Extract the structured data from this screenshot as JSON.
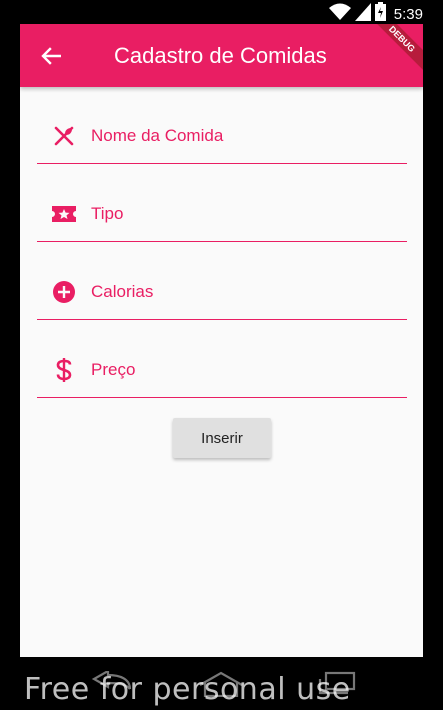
{
  "status_bar": {
    "time": "5:39",
    "icons": [
      "wifi-icon",
      "signal-icon",
      "battery-icon"
    ]
  },
  "app_bar": {
    "title": "Cadastro de Comidas",
    "background": "#e91e63",
    "debug_banner": "DEBUG"
  },
  "form": {
    "fields": [
      {
        "label": "Nome da Comida",
        "icon": "utensils-icon",
        "value": ""
      },
      {
        "label": "Tipo",
        "icon": "ticket-star-icon",
        "value": ""
      },
      {
        "label": "Calorias",
        "icon": "add-circle-icon",
        "value": ""
      },
      {
        "label": "Preço",
        "icon": "dollar-icon",
        "value": ""
      }
    ],
    "submit_label": "Inserir"
  },
  "nav_bar": {
    "items": [
      "back-nav-icon",
      "home-nav-icon",
      "recents-nav-icon"
    ]
  },
  "watermark": "Free for personal use",
  "colors": {
    "accent": "#e91e63",
    "background": "#fafafa",
    "button": "#e0e0e0"
  }
}
